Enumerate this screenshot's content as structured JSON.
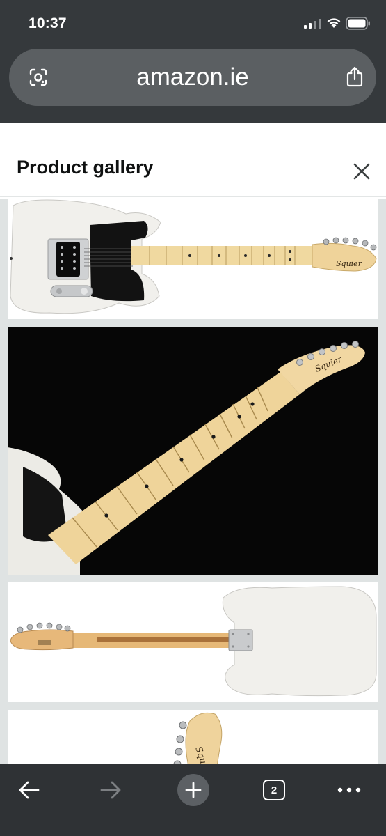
{
  "status_bar": {
    "time": "10:37"
  },
  "address_bar": {
    "url": "amazon.ie",
    "lens_icon": "google-lens-icon",
    "share_icon": "share-icon"
  },
  "gallery": {
    "title": "Product gallery",
    "close_icon": "close-icon",
    "images": [
      {
        "name": "guitar-front-view",
        "headstock_text": "Squier"
      },
      {
        "name": "guitar-neck-closeup",
        "headstock_text": "Squier"
      },
      {
        "name": "guitar-back-view"
      },
      {
        "name": "guitar-headstock-view",
        "headstock_text": "Squier"
      }
    ]
  },
  "toolbar": {
    "back_icon": "back-arrow-icon",
    "forward_icon": "forward-arrow-icon",
    "new_tab_icon": "plus-icon",
    "tab_count": "2",
    "more_icon": "more-icon"
  },
  "colors": {
    "chrome_dark": "#35393c",
    "urlbar": "#5b5f62",
    "page_bg": "#ffffff",
    "gallery_bg": "#dfe3e3"
  }
}
